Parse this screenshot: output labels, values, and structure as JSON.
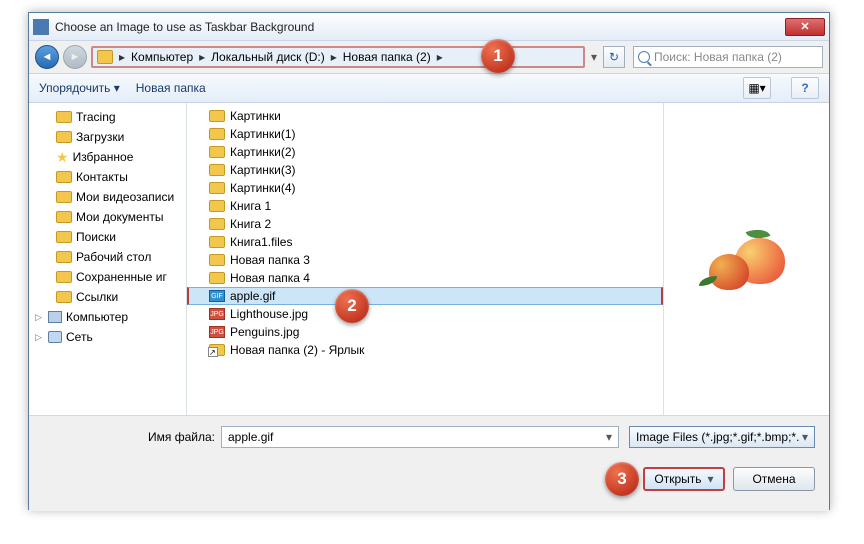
{
  "window": {
    "title": "Choose an Image to use as Taskbar Background"
  },
  "breadcrumb": {
    "parts": [
      "Компьютер",
      "Локальный диск (D:)",
      "Новая папка (2)"
    ]
  },
  "search": {
    "placeholder": "Поиск: Новая папка (2)"
  },
  "toolbar": {
    "organize": "Упорядочить ▾",
    "newfolder": "Новая папка"
  },
  "tree": {
    "items": [
      {
        "label": "Tracing",
        "icon": "fld",
        "lvl": 1
      },
      {
        "label": "Загрузки",
        "icon": "fld",
        "lvl": 1
      },
      {
        "label": "Избранное",
        "icon": "star",
        "lvl": 1
      },
      {
        "label": "Контакты",
        "icon": "fld",
        "lvl": 1
      },
      {
        "label": "Мои видеозаписи",
        "icon": "fld",
        "lvl": 1
      },
      {
        "label": "Мои документы",
        "icon": "fld",
        "lvl": 1
      },
      {
        "label": "Поиски",
        "icon": "fld",
        "lvl": 1
      },
      {
        "label": "Рабочий стол",
        "icon": "fld",
        "lvl": 1
      },
      {
        "label": "Сохраненные иг",
        "icon": "fld",
        "lvl": 1
      },
      {
        "label": "Ссылки",
        "icon": "fld",
        "lvl": 1
      },
      {
        "label": "Компьютер",
        "icon": "comp",
        "lvl": 2,
        "exp": "▷"
      },
      {
        "label": "Сеть",
        "icon": "net",
        "lvl": 2,
        "exp": "▷"
      }
    ]
  },
  "files": {
    "items": [
      {
        "name": "Картинки",
        "kind": "fld"
      },
      {
        "name": "Картинки(1)",
        "kind": "fld"
      },
      {
        "name": "Картинки(2)",
        "kind": "fld"
      },
      {
        "name": "Картинки(3)",
        "kind": "fld"
      },
      {
        "name": "Картинки(4)",
        "kind": "fld"
      },
      {
        "name": "Книга 1",
        "kind": "fld"
      },
      {
        "name": "Книга 2",
        "kind": "fld"
      },
      {
        "name": "Книга1.files",
        "kind": "fld"
      },
      {
        "name": "Новая папка 3",
        "kind": "fld"
      },
      {
        "name": "Новая папка 4",
        "kind": "fld"
      },
      {
        "name": "apple.gif",
        "kind": "gif",
        "selected": true
      },
      {
        "name": "Lighthouse.jpg",
        "kind": "jpg"
      },
      {
        "name": "Penguins.jpg",
        "kind": "jpg"
      },
      {
        "name": "Новая папка (2) - Ярлык",
        "kind": "lnk"
      }
    ]
  },
  "footer": {
    "filename_label": "Имя файла:",
    "filename_value": "apple.gif",
    "filter": "Image Files (*.jpg;*.gif;*.bmp;*.",
    "open": "Открыть",
    "cancel": "Отмена"
  },
  "badges": {
    "b1": "1",
    "b2": "2",
    "b3": "3"
  }
}
